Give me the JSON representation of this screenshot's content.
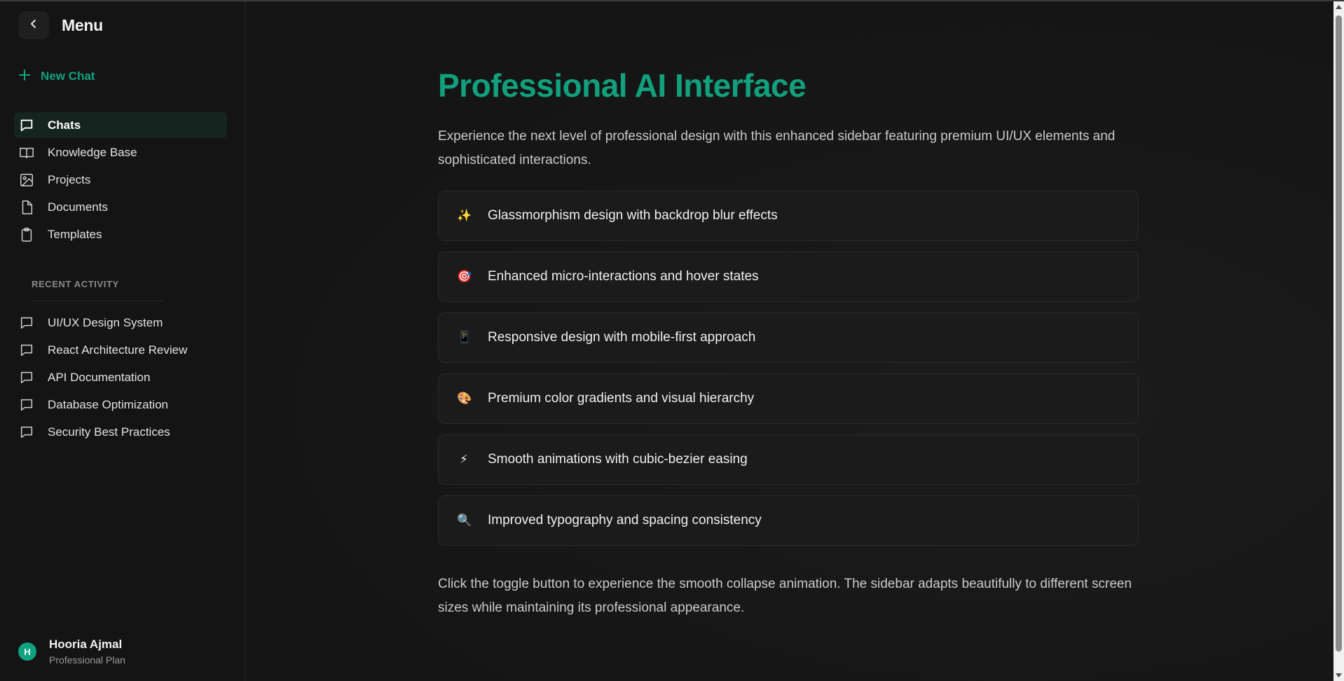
{
  "sidebar": {
    "title": "Menu",
    "new_chat": "New Chat",
    "nav": [
      {
        "label": "Chats",
        "icon": "chat-icon",
        "active": true
      },
      {
        "label": "Knowledge Base",
        "icon": "book-icon"
      },
      {
        "label": "Projects",
        "icon": "image-icon"
      },
      {
        "label": "Documents",
        "icon": "document-icon"
      },
      {
        "label": "Templates",
        "icon": "clipboard-icon"
      }
    ],
    "recent_label": "RECENT ACTIVITY",
    "recent": [
      {
        "label": "UI/UX Design System"
      },
      {
        "label": "React Architecture Review"
      },
      {
        "label": "API Documentation"
      },
      {
        "label": "Database Optimization"
      },
      {
        "label": "Security Best Practices"
      }
    ],
    "user": {
      "initial": "H",
      "name": "Hooria Ajmal",
      "plan": "Professional Plan"
    }
  },
  "main": {
    "title": "Professional AI Interface",
    "intro": "Experience the next level of professional design with this enhanced sidebar featuring premium UI/UX elements and sophisticated interactions.",
    "features": [
      {
        "emoji": "✨",
        "icon": "sparkles-icon",
        "text": "Glassmorphism design with backdrop blur effects"
      },
      {
        "emoji": "🎯",
        "icon": "target-icon",
        "text": "Enhanced micro-interactions and hover states"
      },
      {
        "emoji": "📱",
        "icon": "mobile-icon",
        "text": "Responsive design with mobile-first approach"
      },
      {
        "emoji": "🎨",
        "icon": "palette-icon",
        "text": "Premium color gradients and visual hierarchy"
      },
      {
        "emoji": "⚡",
        "icon": "lightning-icon",
        "text": "Smooth animations with cubic-bezier easing"
      },
      {
        "emoji": "🔍",
        "icon": "magnifier-icon",
        "text": "Improved typography and spacing consistency"
      }
    ],
    "outro": "Click the toggle button to experience the smooth collapse animation. The sidebar adapts beautifully to different screen sizes while maintaining its professional appearance."
  },
  "colors": {
    "accent": "#10a37f",
    "background": "#151515",
    "sidebar": "#141414",
    "card": "#1b1b1b"
  }
}
